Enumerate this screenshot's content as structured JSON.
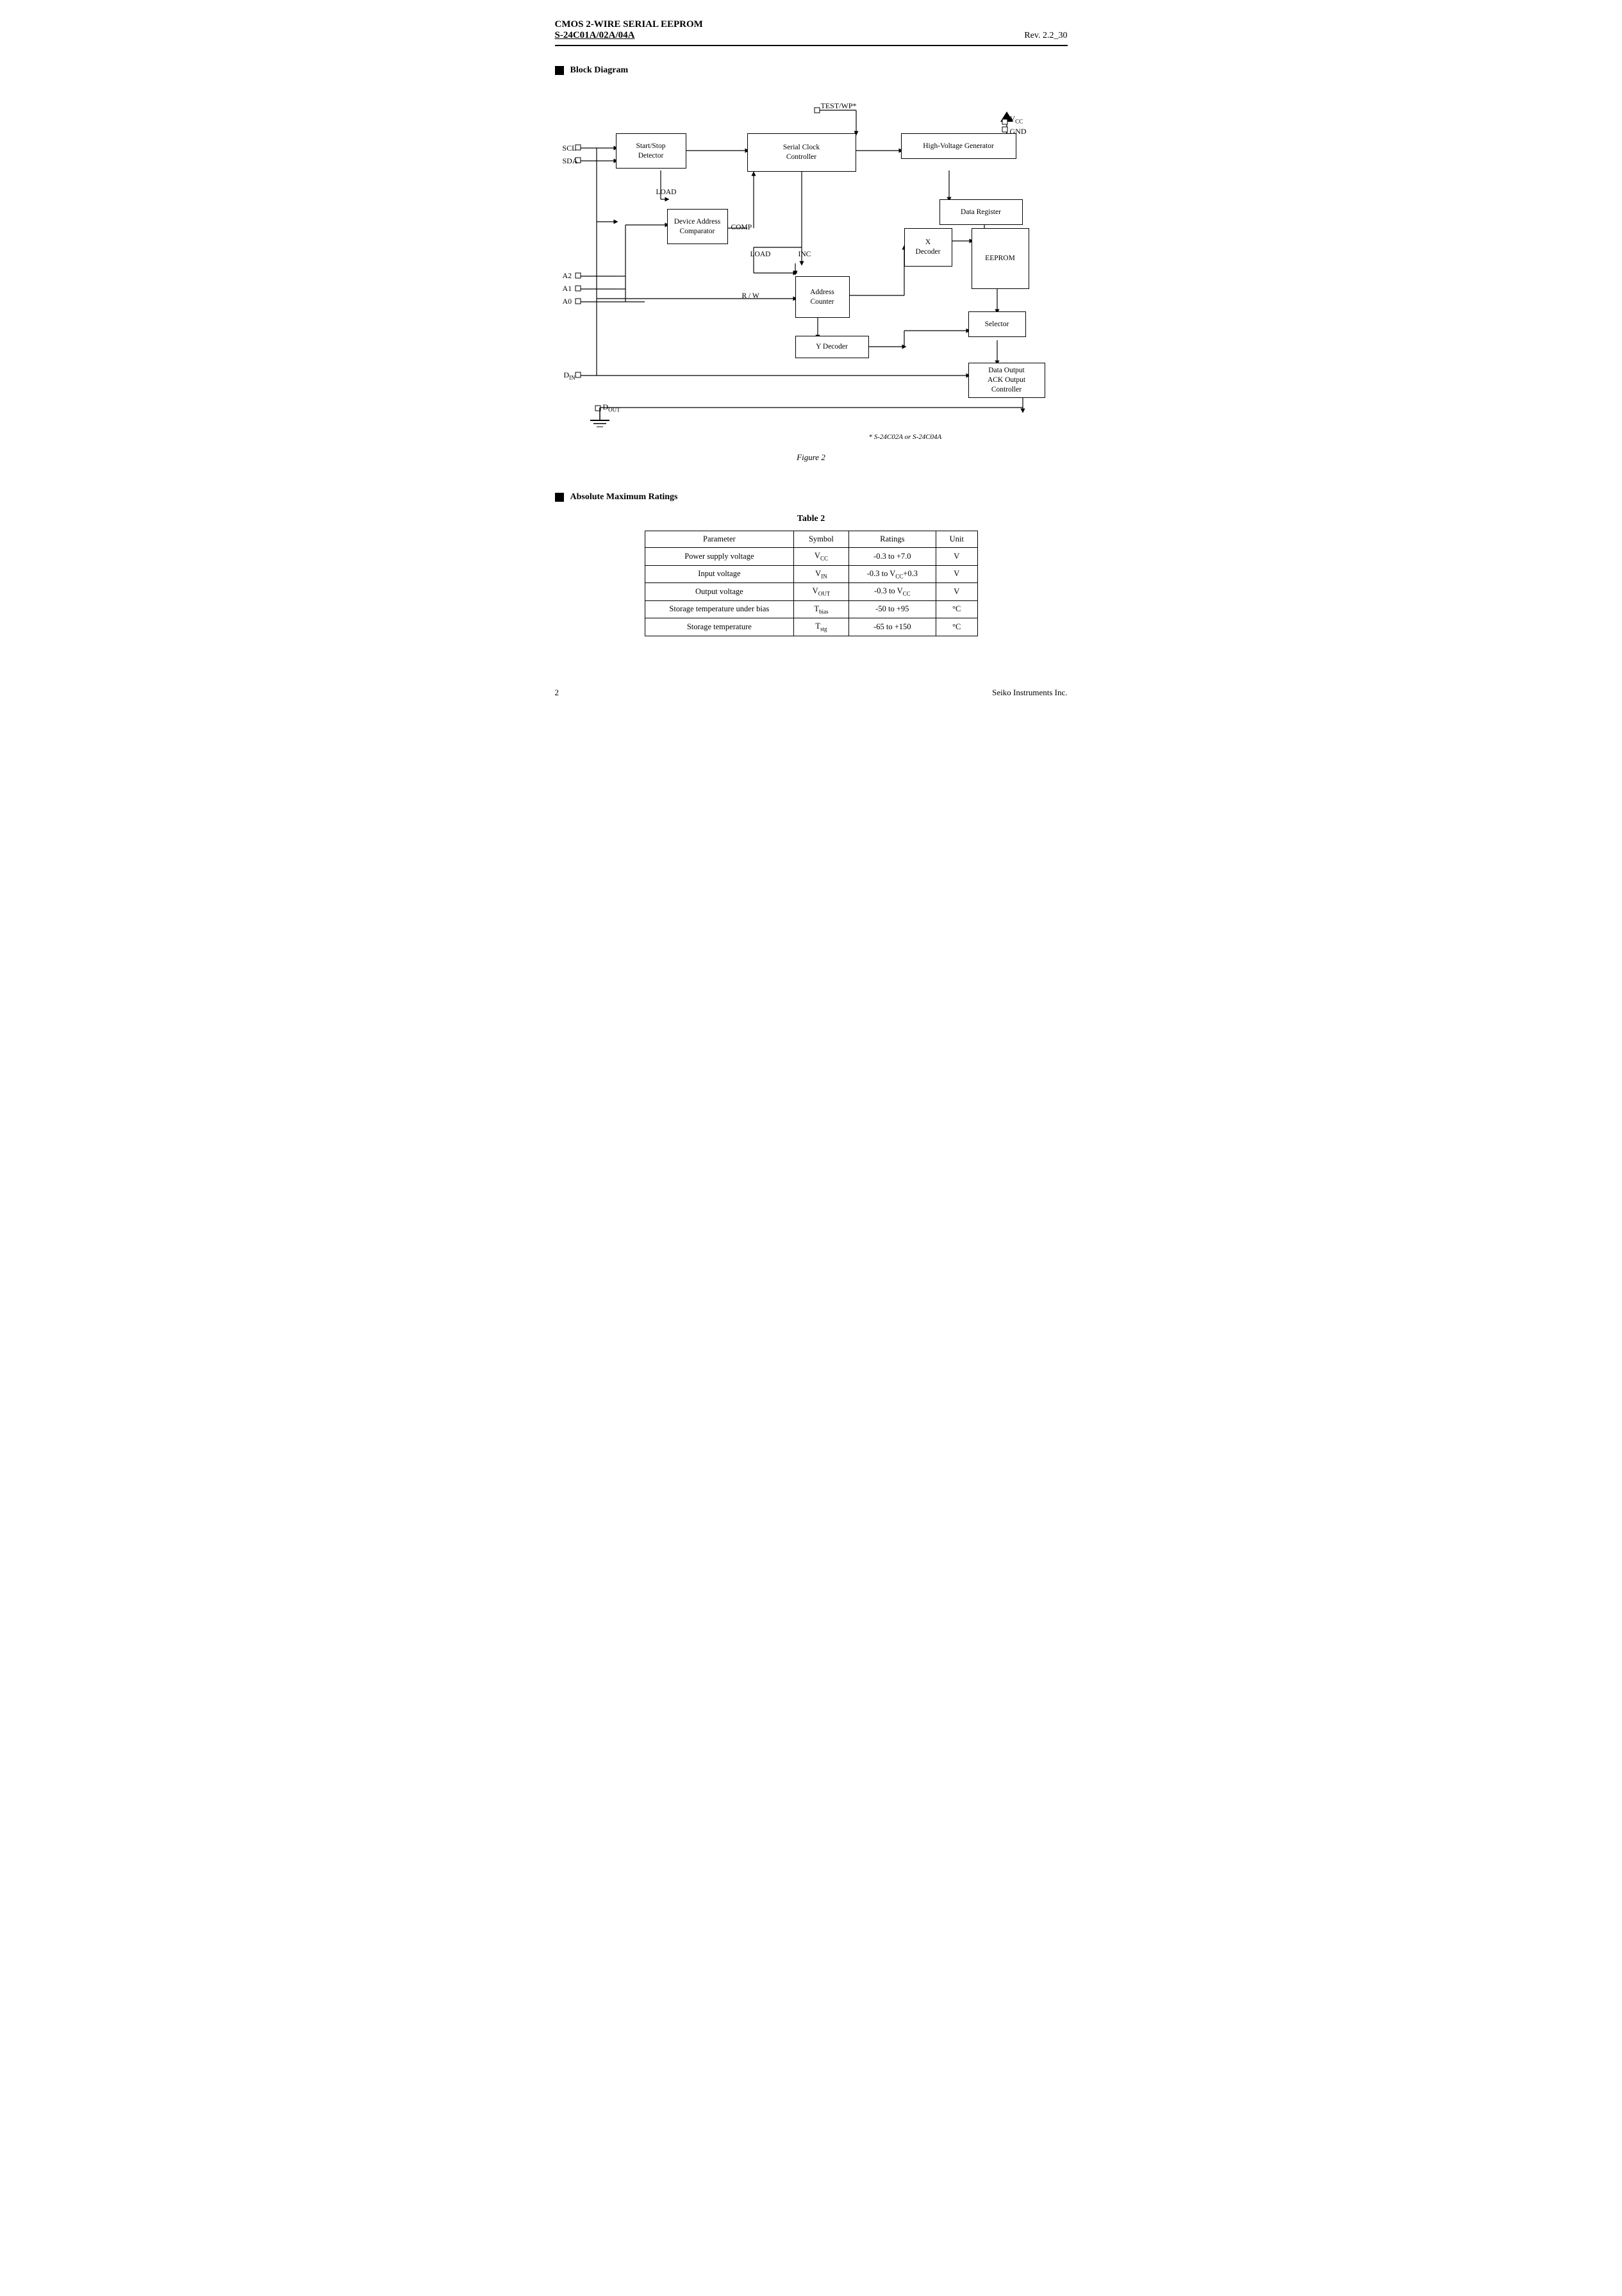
{
  "header": {
    "line1": "CMOS 2-WIRE SERIAL  EEPROM",
    "line2": "S-24C01A/02A/04A",
    "rev": "Rev. 2.2_30"
  },
  "sections": {
    "block_diagram": {
      "heading": "Block Diagram",
      "figure_caption": "Figure 2",
      "footnote": "* S-24C02A or S-24C04A",
      "boxes": {
        "start_stop": "Start/Stop\nDetector",
        "serial_clock": "Serial Clock\nController",
        "high_voltage": "High-Voltage Generator",
        "device_addr": "Device Address\nComparator",
        "data_register": "Data Register",
        "x_decoder": "X\nDecoder",
        "eeprom": "EEPROM",
        "address_counter": "Address\nCounter",
        "y_decoder": "Y Decoder",
        "selector": "Selector",
        "data_output": "Data Output\nACK Output\nController"
      },
      "labels": {
        "scl": "SCL",
        "sda": "SDA",
        "a2": "A2",
        "a1": "A1",
        "a0": "A0",
        "din": "D",
        "din_sub": "IN",
        "dout": "D",
        "dout_sub": "OUT",
        "test_wp": "TEST/WP*",
        "vcc": "V",
        "vcc_sub": "CC",
        "gnd": "GND",
        "load": "LOAD",
        "comp": "COMP",
        "load2": "LOAD",
        "inc": "INC",
        "rw": "R / W"
      }
    },
    "absolute_max": {
      "heading": "Absolute Maximum Ratings",
      "table_title": "Table  2",
      "columns": [
        "Parameter",
        "Symbol",
        "Ratings",
        "Unit"
      ],
      "rows": [
        {
          "param": "Power supply voltage",
          "symbol": "V_CC",
          "ratings": "-0.3 to +7.0",
          "unit": "V"
        },
        {
          "param": "Input voltage",
          "symbol": "V_IN",
          "ratings": "-0.3 to V_CC+0.3",
          "unit": "V"
        },
        {
          "param": "Output voltage",
          "symbol": "V_OUT",
          "ratings": "-0.3 to V_CC",
          "unit": "V"
        },
        {
          "param": "Storage temperature under bias",
          "symbol": "T_bias",
          "ratings": "-50 to +95",
          "unit": "°C"
        },
        {
          "param": "Storage temperature",
          "symbol": "T_stg",
          "ratings": "-65 to +150",
          "unit": "°C"
        }
      ]
    }
  },
  "footer": {
    "page": "2",
    "company": "Seiko Instruments Inc."
  }
}
